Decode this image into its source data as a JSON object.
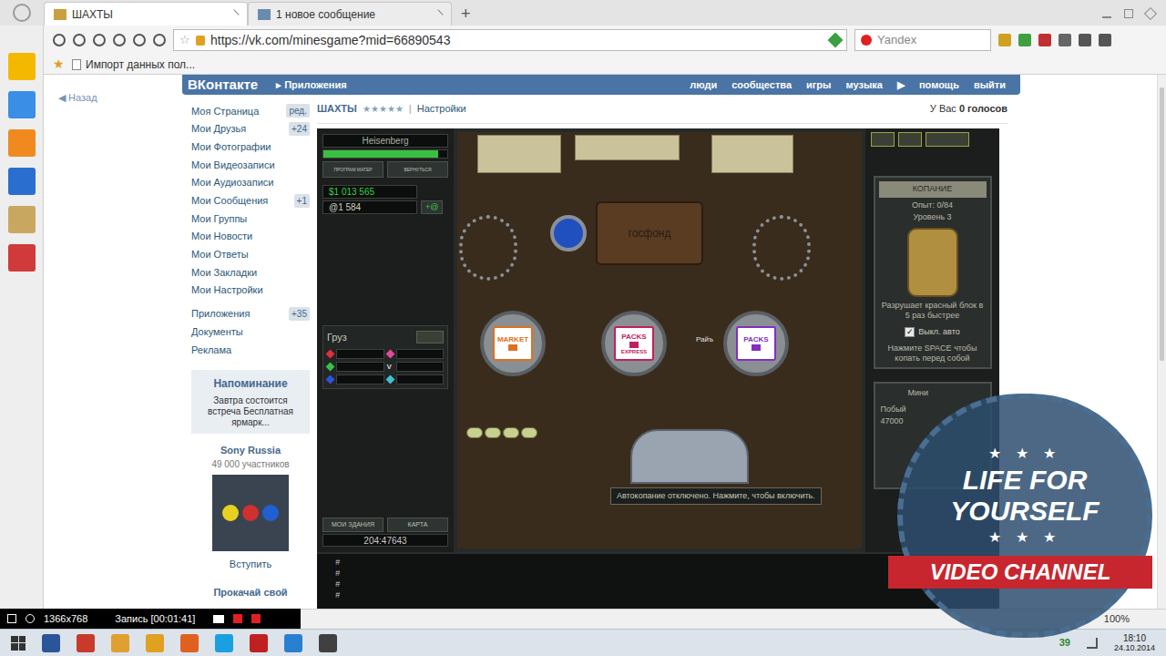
{
  "browser": {
    "tabs": [
      {
        "label": "ШАХТЫ",
        "selected": true
      },
      {
        "label": "1 новое сообщение",
        "selected": false
      }
    ],
    "new_tab": "+",
    "url": "https://vk.com/minesgame?mid=66890543",
    "search": {
      "placeholder": "Yandex"
    },
    "bookmarks": [
      "Импорт данных пол..."
    ],
    "zoom": "100%"
  },
  "vk": {
    "logo": "ВКонтакте",
    "back": "Назад",
    "apps_link": "Приложения",
    "nav": [
      "люди",
      "сообщества",
      "игры",
      "музыка",
      "▶",
      "помощь",
      "выйти"
    ],
    "menu": [
      {
        "label": "Моя Страница",
        "badge": "ред."
      },
      {
        "label": "Мои Друзья",
        "badge": "+24"
      },
      {
        "label": "Мои Фотографии",
        "badge": ""
      },
      {
        "label": "Мои Видеозаписи",
        "badge": ""
      },
      {
        "label": "Мои Аудиозаписи",
        "badge": ""
      },
      {
        "label": "Мои Сообщения",
        "badge": "+1"
      },
      {
        "label": "Мои Группы",
        "badge": ""
      },
      {
        "label": "Мои Новости",
        "badge": ""
      },
      {
        "label": "Мои Ответы",
        "badge": ""
      },
      {
        "label": "Мои Закладки",
        "badge": ""
      },
      {
        "label": "Мои Настройки",
        "badge": ""
      }
    ],
    "menu2": [
      {
        "label": "Приложения",
        "badge": "+35"
      },
      {
        "label": "Документы",
        "badge": ""
      },
      {
        "label": "Реклама",
        "badge": ""
      }
    ],
    "reminder": {
      "title": "Напоминание",
      "text": "Завтра состоится встреча Бесплатная ярмарк..."
    },
    "group": {
      "name": "Sony Russia",
      "members": "49 000 участников",
      "join": "Вступить"
    },
    "promo": "Прокачай свой",
    "app": {
      "title": "ШАХТЫ",
      "stars": 5,
      "settings": "Настройки",
      "votes_prefix": "У Вас",
      "votes": "0 голосов"
    }
  },
  "game": {
    "player": "Heisenberg",
    "health": 0.93,
    "buttons": [
      "ПРОГРАМ МАТЕР",
      "ВЕРНУТЬСЯ"
    ],
    "money": "$1 013 565",
    "credits": "@1 584",
    "add_credits": "+@",
    "cargo": {
      "title": "Груз",
      "slots": [
        {
          "kind": "dot",
          "color": "#e0303a",
          "glyph": ""
        },
        {
          "kind": "dot",
          "color": "#e04a9a",
          "glyph": ""
        },
        {
          "kind": "dot",
          "color": "#38c048",
          "glyph": ""
        },
        {
          "kind": "glyph",
          "color": "#d8d8d8",
          "glyph": "V"
        },
        {
          "kind": "dot",
          "color": "#3050e0",
          "glyph": ""
        },
        {
          "kind": "dot",
          "color": "#40c0d0",
          "glyph": ""
        }
      ]
    },
    "sign": "госфонд",
    "buildings": [
      {
        "label": "MARKET",
        "sub": "",
        "color": "#e07020"
      },
      {
        "label": "PACKS",
        "sub": "EXPRESS",
        "color": "#c02060"
      },
      {
        "label": "PACKS",
        "sub": "",
        "color": "#8030c0"
      }
    ],
    "drop_label": "Райъ",
    "skill": {
      "title": "КОПАНИЕ",
      "exp": "Опыт: 0/84",
      "level": "Уровень 3",
      "desc": "Разрушает красный блок в 5 раз быстрее",
      "auto": {
        "label": "Выкл. авто",
        "checked": true
      },
      "hint": "Нажмите SPACE чтобы копать перед собой"
    },
    "mini": {
      "title": "Мини",
      "line": "Побый",
      "value": "47000"
    },
    "toast": "Автокопание отключено. Нажмите, чтобы включить.",
    "bottom_buttons": [
      "МОИ ЗДАНИЯ",
      "КАРТА"
    ],
    "coords": "204:47643",
    "console": [
      "#",
      "#",
      "#",
      "#"
    ]
  },
  "recorder": {
    "resolution": "1366x768",
    "status": "Запись [00:01:41]"
  },
  "taskbar": {
    "tray_badge": "39",
    "time": "18:10",
    "date": "24.10.2014"
  },
  "watermark": {
    "stars": "★ ★ ★",
    "line1": "LIFE FOR",
    "line2": "YOURSELF",
    "banner": "VIDEO CHANNEL"
  }
}
